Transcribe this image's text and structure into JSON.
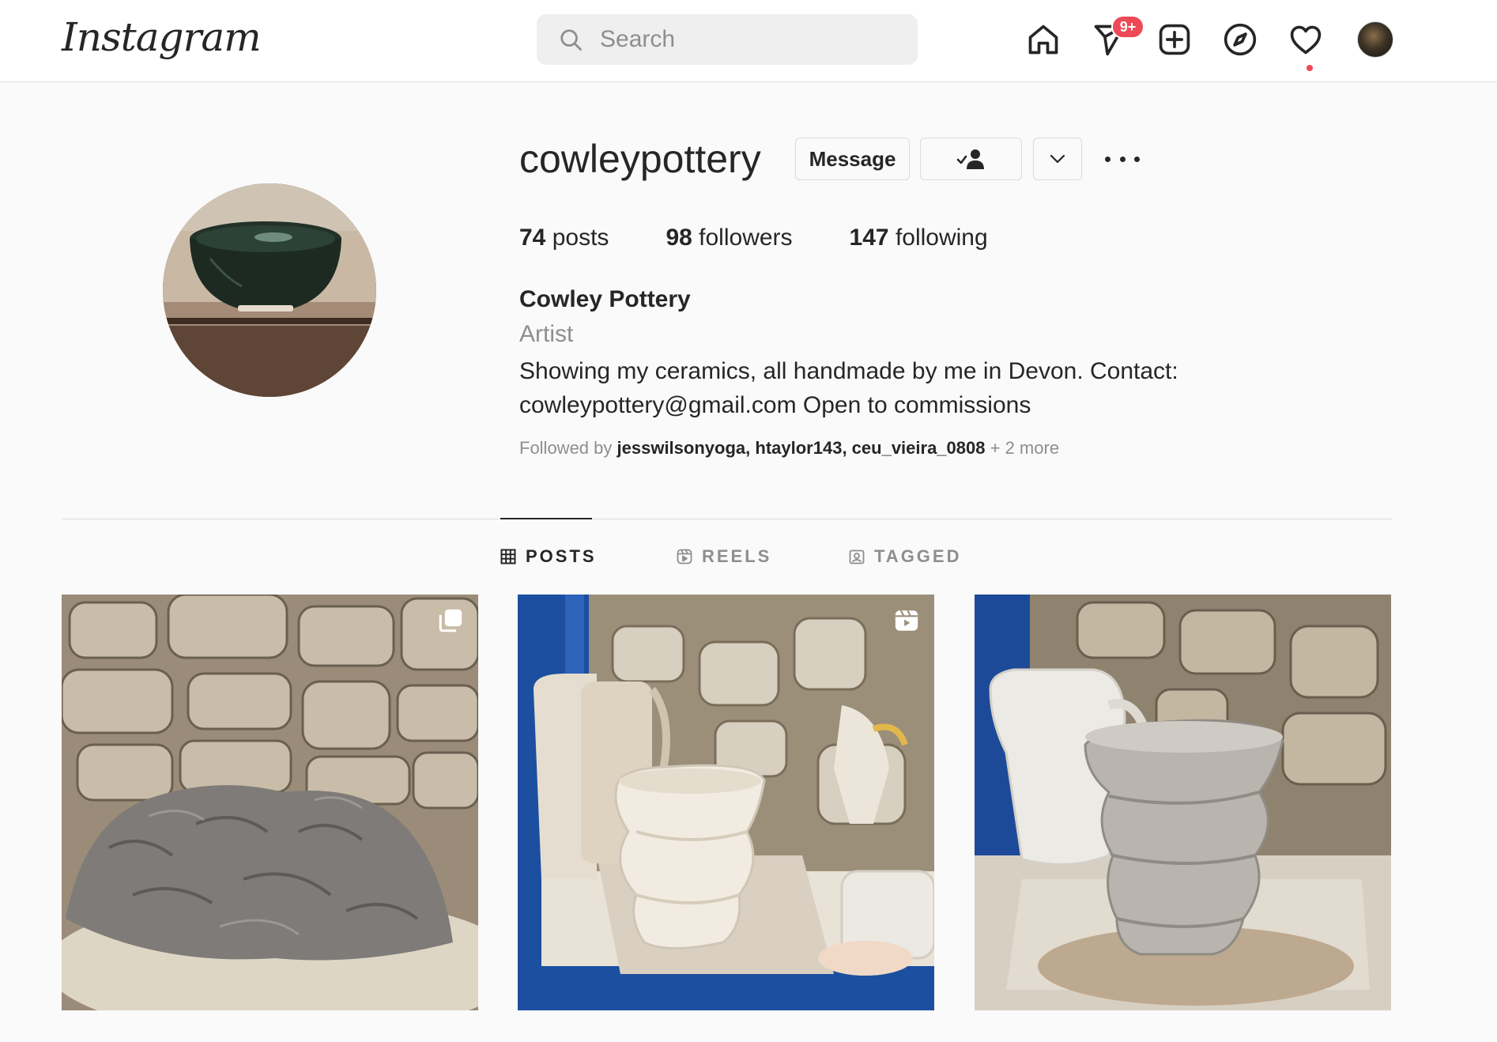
{
  "nav": {
    "logo": "Instagram",
    "search_placeholder": "Search",
    "notification_badge": "9+",
    "icons": [
      "home-icon",
      "direct-messages-icon",
      "new-post-icon",
      "explore-icon",
      "activity-heart-icon",
      "profile-avatar"
    ]
  },
  "profile": {
    "username": "cowleypottery",
    "message_label": "Message",
    "posts_count": "74",
    "posts_label": "posts",
    "followers_count": "98",
    "followers_label": "followers",
    "following_count": "147",
    "following_label": "following",
    "full_name": "Cowley Pottery",
    "category": "Artist",
    "bio_line1": "Showing my ceramics, all handmade by me in Devon. Contact:",
    "bio_line2": "cowleypottery@gmail.com Open to commissions",
    "followed_by_prefix": "Followed by ",
    "followed_by": [
      "jesswilsonyoga",
      "htaylor143",
      "ceu_vieira_0808"
    ],
    "followed_by_more": "+ 2 more"
  },
  "tabs": [
    {
      "label": "POSTS",
      "icon": "grid-icon",
      "active": true
    },
    {
      "label": "REELS",
      "icon": "reels-icon",
      "active": false
    },
    {
      "label": "TAGGED",
      "icon": "tagged-icon",
      "active": false
    }
  ],
  "posts": [
    {
      "subject": "clay-mound",
      "overlay_icon": "carousel-icon"
    },
    {
      "subject": "white-thrown-vase",
      "overlay_icon": "reel-icon"
    },
    {
      "subject": "grey-thrown-vase",
      "overlay_icon": ""
    }
  ],
  "colors": {
    "badge": "#ed4956",
    "text": "#262626",
    "secondary": "#8e8e8e",
    "border": "#dbdbdb",
    "background": "#fafafa"
  }
}
